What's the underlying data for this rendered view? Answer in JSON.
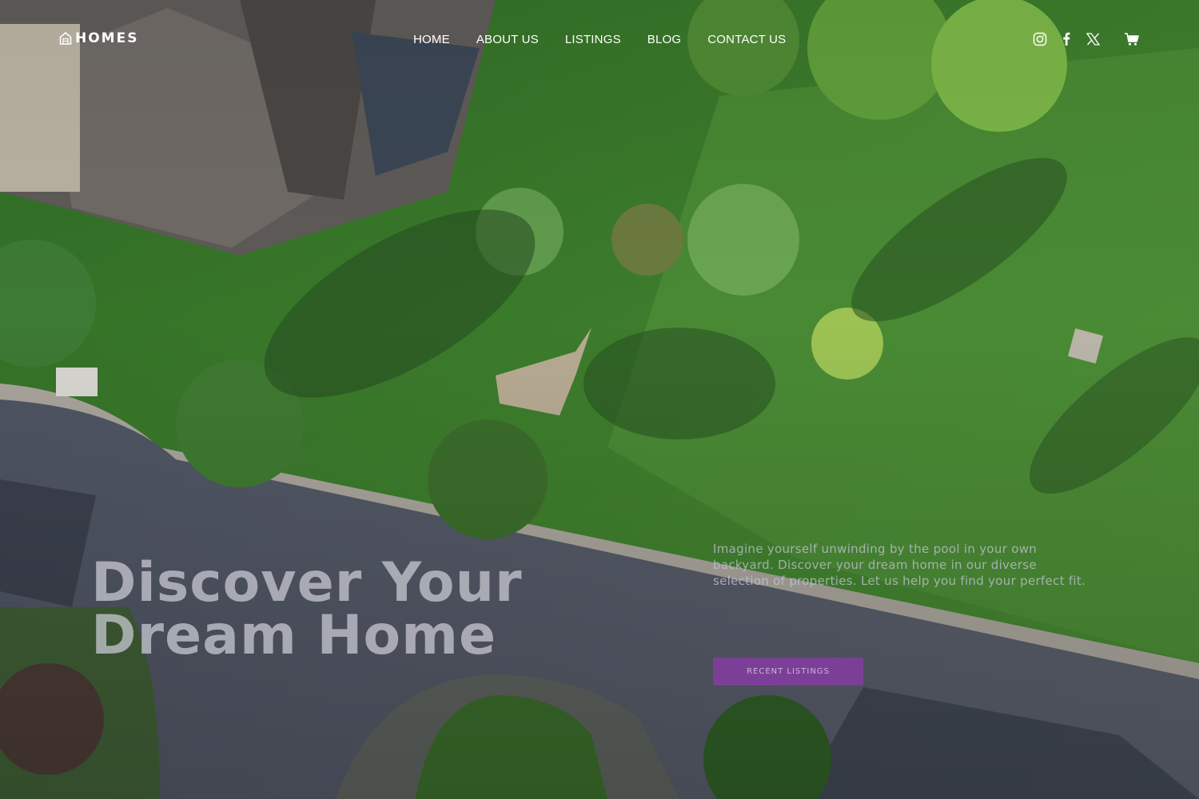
{
  "brand": {
    "name": "HOMES",
    "icon": "house-icon"
  },
  "nav": {
    "items": [
      {
        "label": "HOME"
      },
      {
        "label": "ABOUT US"
      },
      {
        "label": "LISTINGS"
      },
      {
        "label": "BLOG"
      },
      {
        "label": "CONTACT US"
      }
    ]
  },
  "social": {
    "icons": [
      "instagram-icon",
      "facebook-icon",
      "x-twitter-icon"
    ],
    "cart_icon": "cart-icon"
  },
  "hero": {
    "title_line1": "Discover Your",
    "title_line2": "Dream Home",
    "description": "Imagine yourself unwinding by the pool in your own backyard. Discover your dream home in our diverse selection of properties. Let us help you find your perfect fit.",
    "cta_label": "RECENT LISTINGS"
  },
  "colors": {
    "accent": "#8b3ba8",
    "nav_text": "#ffffff",
    "title_text": "#cdcdd7"
  }
}
